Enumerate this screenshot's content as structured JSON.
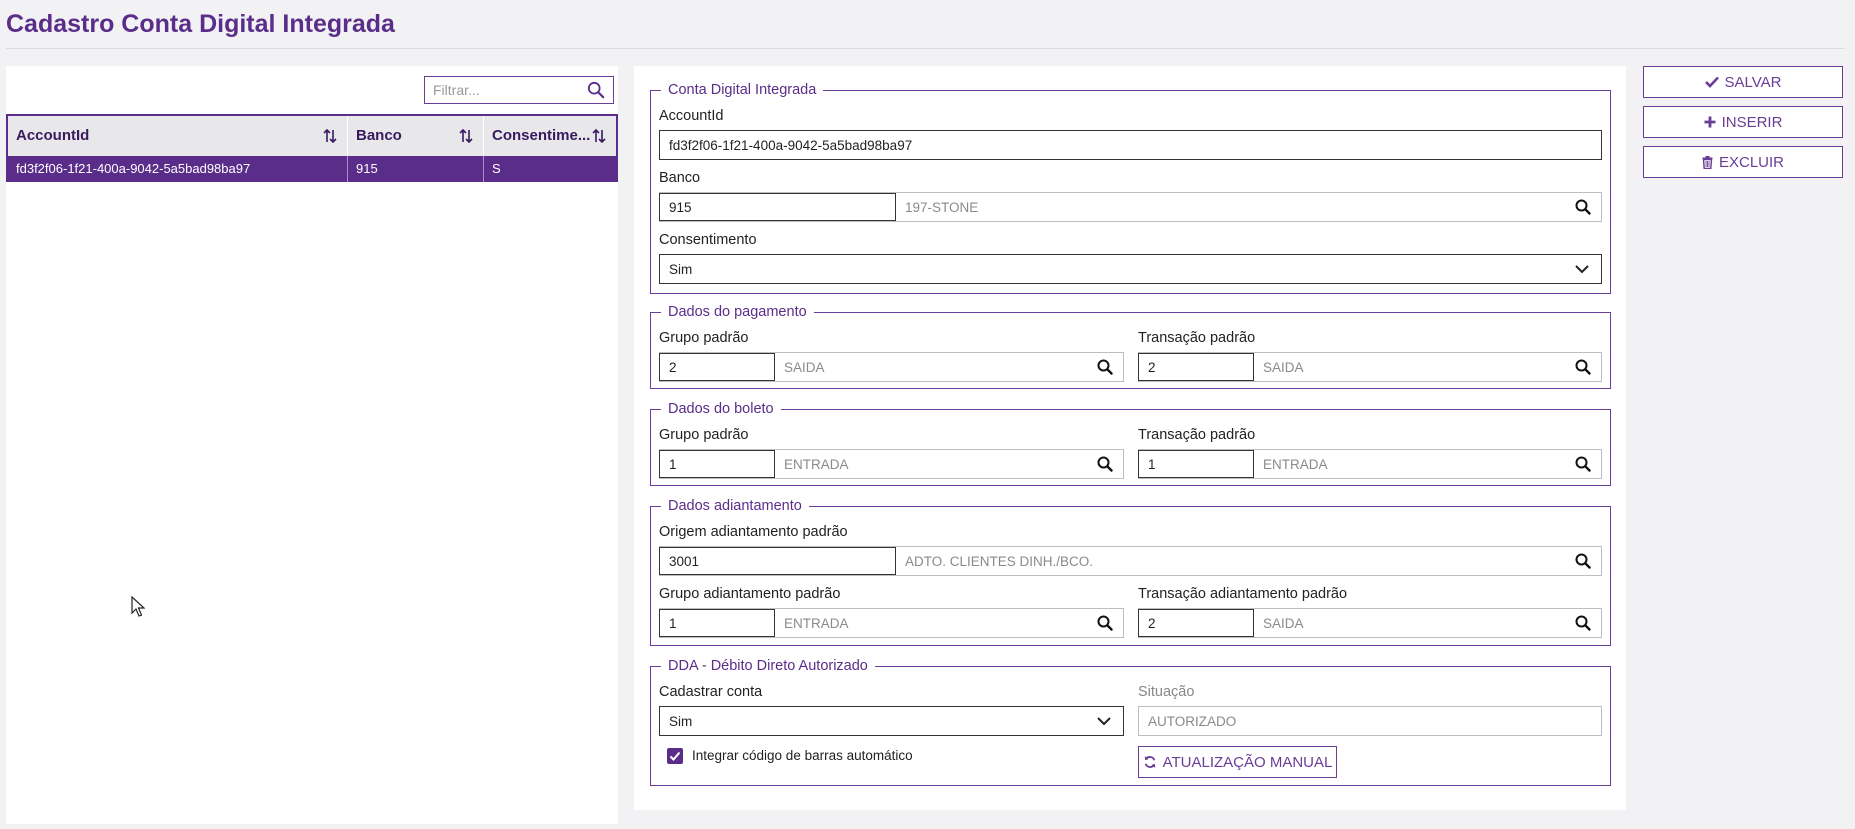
{
  "page": {
    "title": "Cadastro Conta Digital Integrada"
  },
  "list": {
    "filter_placeholder": "Filtrar...",
    "columns": [
      "AccountId",
      "Banco",
      "Consentime..."
    ],
    "rows": [
      {
        "account_id": "fd3f2f06-1f21-400a-9042-5a5bad98ba97",
        "banco": "915",
        "consentimento": "S"
      }
    ]
  },
  "conta": {
    "legend": "Conta Digital Integrada",
    "account_label": "AccountId",
    "account_value": "fd3f2f06-1f21-400a-9042-5a5bad98ba97",
    "banco_label": "Banco",
    "banco_code": "915",
    "banco_desc": "197-STONE",
    "consent_label": "Consentimento",
    "consent_value": "Sim"
  },
  "pagamento": {
    "legend": "Dados do pagamento",
    "grupo_label": "Grupo padrão",
    "grupo_code": "2",
    "grupo_desc": "SAIDA",
    "trans_label": "Transação padrão",
    "trans_code": "2",
    "trans_desc": "SAIDA"
  },
  "boleto": {
    "legend": "Dados do boleto",
    "grupo_label": "Grupo padrão",
    "grupo_code": "1",
    "grupo_desc": "ENTRADA",
    "trans_label": "Transação padrão",
    "trans_code": "1",
    "trans_desc": "ENTRADA"
  },
  "adiantamento": {
    "legend": "Dados adiantamento",
    "origem_label": "Origem adiantamento padrão",
    "origem_code": "3001",
    "origem_desc": "ADTO. CLIENTES DINH./BCO.",
    "grupo_label": "Grupo adiantamento padrão",
    "grupo_code": "1",
    "grupo_desc": "ENTRADA",
    "trans_label": "Transação adiantamento padrão",
    "trans_code": "2",
    "trans_desc": "SAIDA"
  },
  "dda": {
    "legend": "DDA - Débito Direto Autorizado",
    "cadastrar_label": "Cadastrar conta",
    "cadastrar_value": "Sim",
    "situacao_label": "Situação",
    "situacao_value": "AUTORIZADO",
    "checkbox_label": "Integrar código de barras automático",
    "checkbox_checked": true,
    "update_button": "ATUALIZAÇÃO MANUAL"
  },
  "actions": {
    "save": "SALVAR",
    "insert": "INSERIR",
    "delete": "EXCLUIR"
  },
  "colors": {
    "accent": "#5b2d8a",
    "border": "#6a3d96"
  }
}
